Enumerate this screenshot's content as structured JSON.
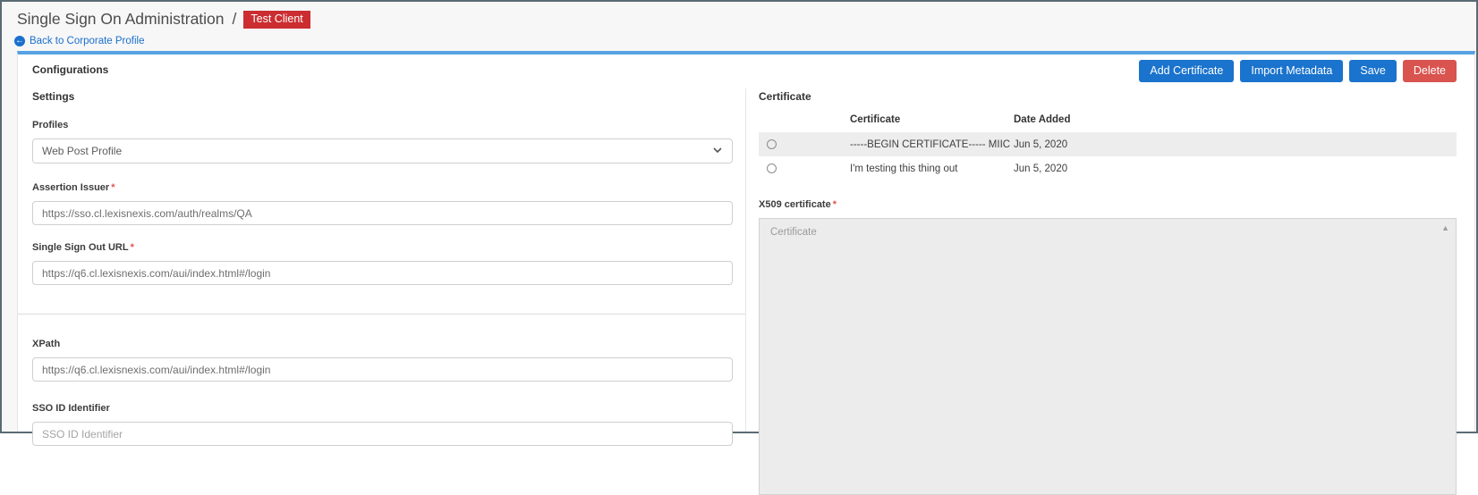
{
  "page": {
    "title": "Single Sign On Administration",
    "title_separator": "/",
    "client_badge": "Test Client",
    "back_link_label": "Back to Corporate Profile"
  },
  "toolbar": {
    "buttons": [
      {
        "label": "Add Certificate"
      },
      {
        "label": "Import Metadata"
      },
      {
        "label": "Save"
      },
      {
        "label": "Delete"
      }
    ]
  },
  "card": {
    "heading": "Configurations"
  },
  "settings": {
    "heading": "Settings",
    "profiles": {
      "label": "Profiles",
      "selected": "Web Post Profile"
    },
    "assertion_issuer": {
      "label": "Assertion Issuer",
      "required_marker": "*",
      "value": "https://sso.cl.lexisnexis.com/auth/realms/QA"
    },
    "single_sign_out_url": {
      "label": "Single Sign Out URL",
      "required_marker": "*",
      "value": "https://q6.cl.lexisnexis.com/aui/index.html#/login"
    },
    "xpath": {
      "label": "XPath",
      "value": "https://q6.cl.lexisnexis.com/aui/index.html#/login"
    },
    "sso_id_identifier": {
      "label": "SSO ID Identifier",
      "placeholder": "SSO ID Identifier",
      "value": ""
    }
  },
  "certificate_section": {
    "heading": "Certificate",
    "table": {
      "columns": {
        "certificate": "Certificate",
        "date_added": "Date Added"
      },
      "rows": [
        {
          "certificate": "-----BEGIN CERTIFICATE----- MIICkzCCA...",
          "date_added": "Jun 5, 2020",
          "selected": false
        },
        {
          "certificate": "I'm testing this thing out",
          "date_added": "Jun 5, 2020",
          "selected": false
        }
      ]
    },
    "x509": {
      "label": "X509 certificate",
      "required_marker": "*",
      "placeholder": "Certificate",
      "value": ""
    }
  },
  "colors": {
    "primary_blue": "#1a73cd",
    "accent_line_blue": "#57a1e3",
    "link_blue": "#1b6fce",
    "badge_red": "#cb2d31",
    "delete_red": "#d9534f",
    "row_stripe_gray": "#ededed"
  }
}
